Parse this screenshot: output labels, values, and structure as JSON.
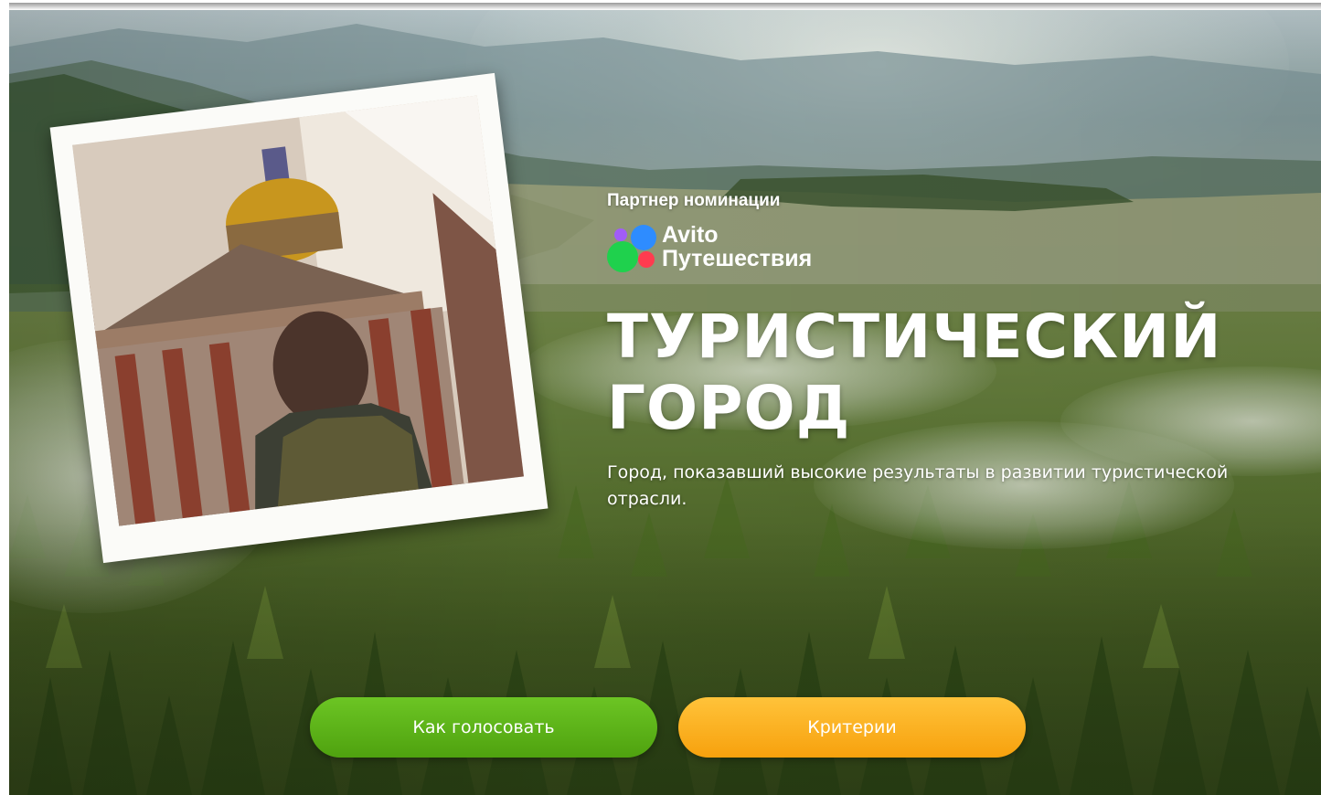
{
  "hero": {
    "partner_label": "Партнер номинации",
    "partner_brand": "Avito",
    "partner_brand_sub": "Путешествия",
    "title_line1": "ТУРИСТИЧЕСКИЙ",
    "title_line2": "ГОРОД",
    "description": "Город, показавший высокие результаты в развитии туристической отрасли."
  },
  "buttons": {
    "vote_label": "Как голосовать",
    "criteria_label": "Критерии"
  },
  "colors": {
    "vote_button": "#5bb318",
    "criteria_button": "#fbb124",
    "logo_purple": "#a15cf7",
    "logo_blue": "#2e8cff",
    "logo_green": "#1fd14d",
    "logo_red": "#ff3b4f"
  },
  "icons": {
    "partner_logo": "avito-dots-logo"
  }
}
